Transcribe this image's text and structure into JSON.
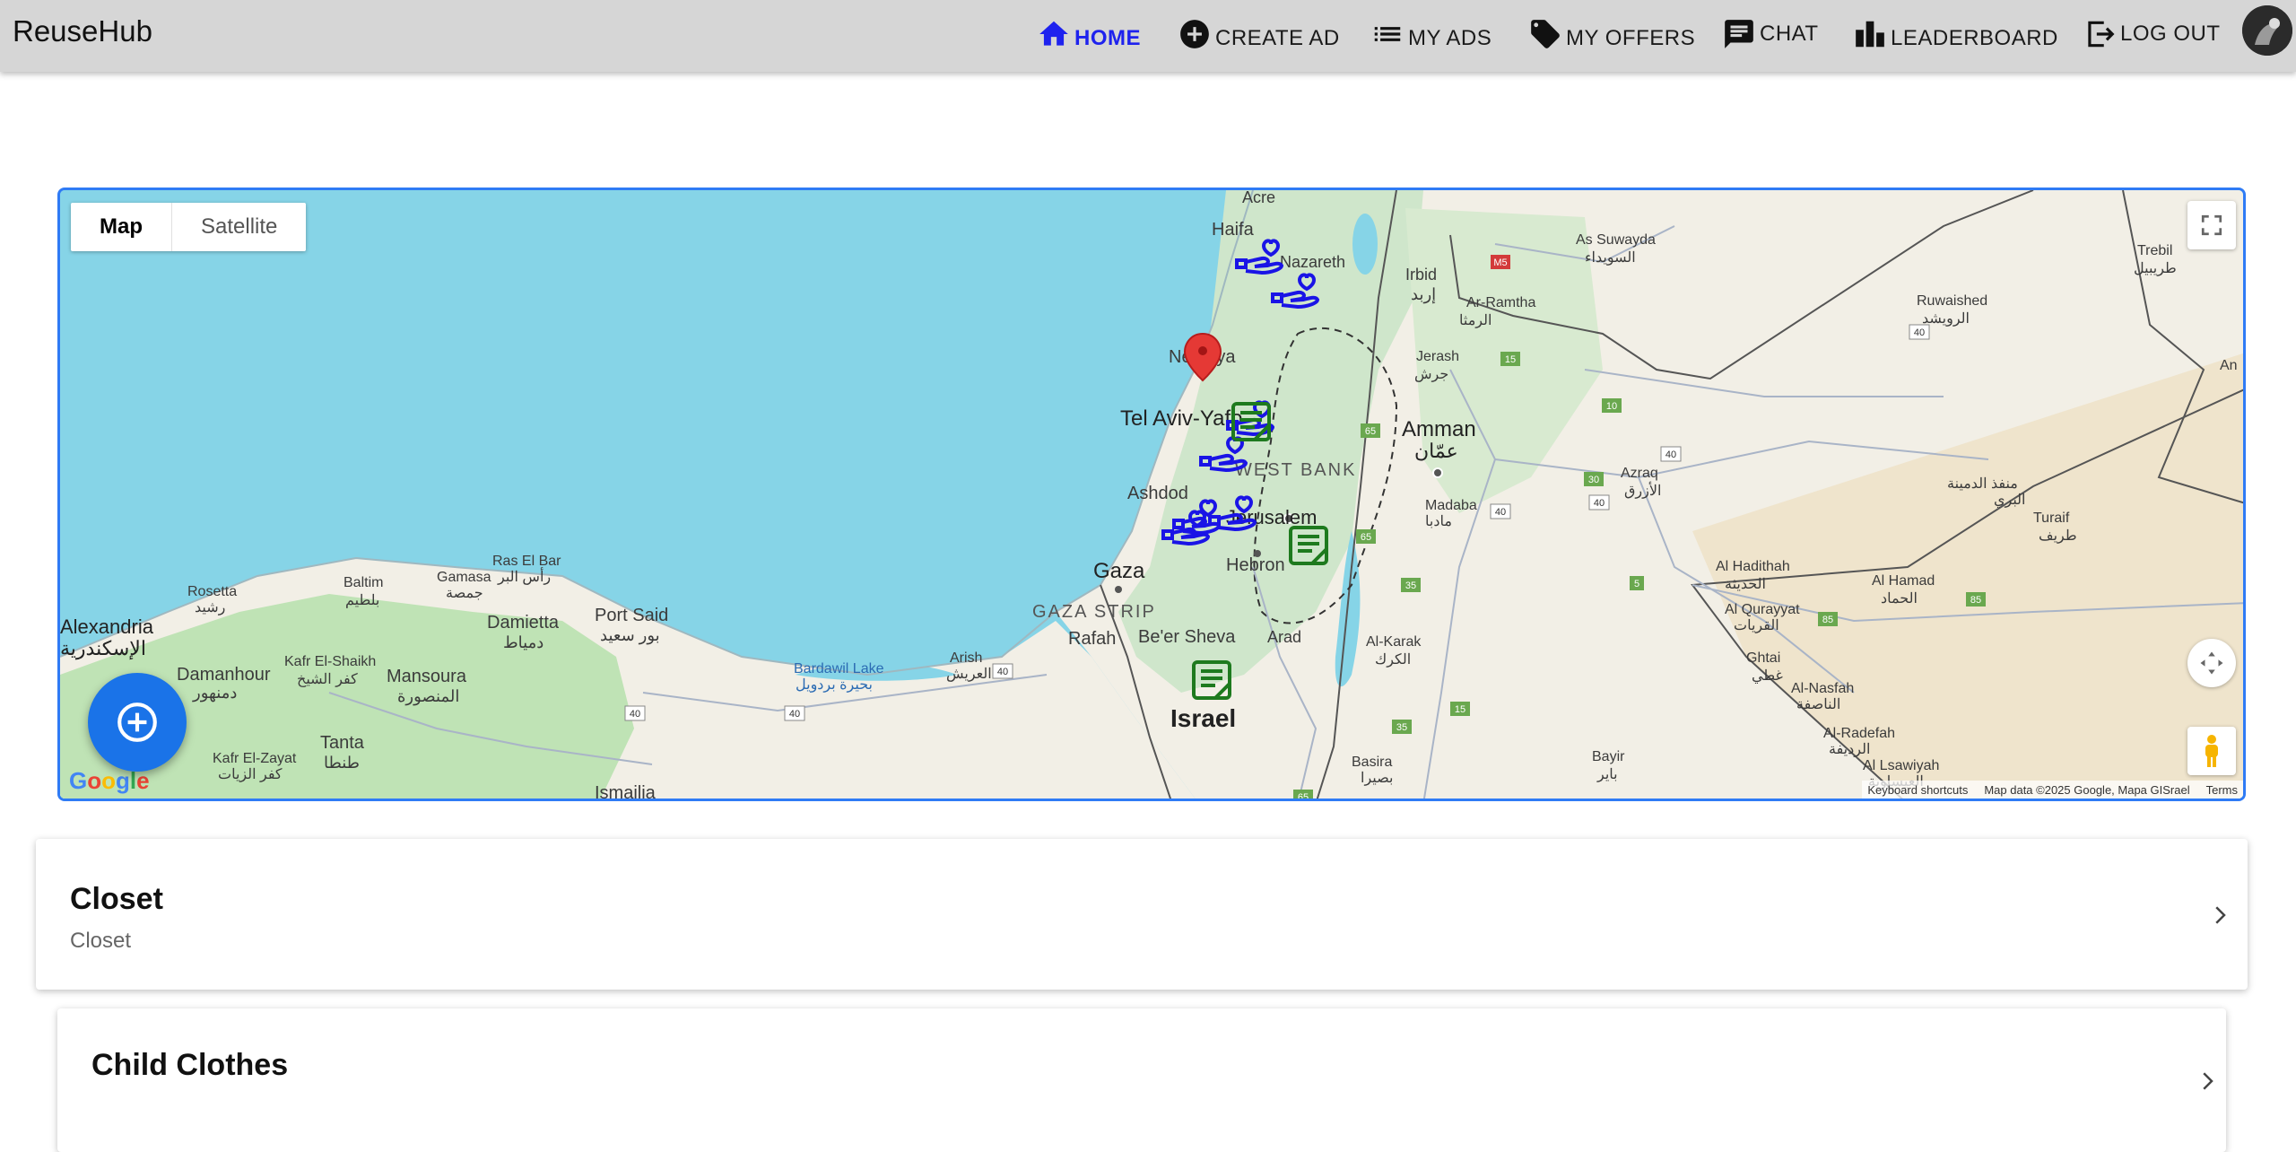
{
  "app": {
    "brand": "ReuseHub"
  },
  "nav": {
    "home": "HOME",
    "create_ad": "CREATE AD",
    "my_ads": "MY ADS",
    "my_offers": "MY OFFERS",
    "chat": "CHAT",
    "leaderboard": "LEADERBOARD",
    "logout": "LOG OUT",
    "active": "home",
    "active_color": "#1e22ee"
  },
  "map": {
    "type_map": "Map",
    "type_satellite": "Satellite",
    "attribution": {
      "shortcuts": "Keyboard shortcuts",
      "data": "Map data ©2025 Google, Mapa GISrael",
      "terms": "Terms"
    },
    "google_logo": "Google",
    "labels": {
      "acre": "Acre",
      "haifa": "Haifa",
      "nazareth": "Nazareth",
      "netanya": "Netanya",
      "tel_aviv": "Tel Aviv-Yafo",
      "ashdod": "Ashdod",
      "jerusalem": "Jerusalem",
      "west_bank": "WEST BANK",
      "gaza": "Gaza",
      "gaza_strip": "GAZA STRIP",
      "rafah": "Rafah",
      "hebron": "Hebron",
      "beer_sheva": "Be'er Sheva",
      "arad": "Arad",
      "israel": "Israel",
      "amman": "Amman",
      "amman_ar": "عمّان",
      "irbid": "Irbid",
      "irbid_ar": "إربد",
      "ar_ramtha": "Ar-Ramtha",
      "ar_ramtha_ar": "الرمثا",
      "jerash": "Jerash",
      "jerash_ar": "جرش",
      "as_suwayda": "As Suwayda",
      "as_suwayda_ar": "السويداء",
      "ruwaished": "Ruwaished",
      "ruwaished_ar": "الرويشد",
      "trebil": "Trebil",
      "trebil_ar": "طريبيل",
      "azraq": "Azraq",
      "azraq_ar": "الأزرق",
      "madaba": "Madaba",
      "madaba_ar": "مادبا",
      "al_karak": "Al-Karak",
      "al_karak_ar": "الكرك",
      "basira": "Basira",
      "basira_ar": "بصيرا",
      "bayir": "Bayir",
      "bayir_ar": "باير",
      "al_hadithah": "Al Hadithah",
      "al_hadithah_ar": "الحديثة",
      "al_qurayyat": "Al Qurayyat",
      "al_qurayyat_ar": "القريات",
      "al_hamad": "Al Hamad",
      "al_hamad_ar": "الحماد",
      "turaif": "Turaif",
      "turaif_ar": "طريف",
      "ghtai": "Ghtai",
      "ghtai_ar": "غطي",
      "al_nasfah": "Al-Nasfah",
      "al_nasfah_ar": "الناصفة",
      "al_radefah": "Al-Radefah",
      "al_radefah_ar": "الرديفة",
      "al_lsawiyah": "Al Lsawiyah",
      "al_lsawiyah_ar": "العيساوية",
      "manfadh": "منفذ الدمينة",
      "manfadh2": "البري",
      "alexandria": "Alexandria",
      "alexandria_ar": "الإسكندرية",
      "rosetta": "Rosetta",
      "rosetta_ar": "رشيد",
      "baltim": "Baltim",
      "baltim_ar": "بلطيم",
      "gamasa": "Gamasa",
      "gamasa_ar": "جمصة",
      "ras_el_bar": "Ras El Bar",
      "ras_el_bar_ar": "رأس البر",
      "damietta": "Damietta",
      "damietta_ar": "دمياط",
      "port_said": "Port Said",
      "port_said_ar": "بور سعيد",
      "damanhour": "Damanhour",
      "damanhour_ar": "دمنهور",
      "kafr_el_shaikh": "Kafr El-Shaikh",
      "kafr_el_shaikh_ar": "كفر الشيخ",
      "mansoura": "Mansoura",
      "mansoura_ar": "المنصورة",
      "tanta": "Tanta",
      "tanta_ar": "طنطا",
      "kafr_el_zayat": "Kafr El-Zayat",
      "kafr_el_zayat_ar": "كفر الزيات",
      "ismailia": "Ismailia",
      "arish": "Arish",
      "arish_ar": "العريش",
      "bardawil": "Bardawil Lake",
      "bardawil_ar": "بحيرة بردويل",
      "an": "An"
    },
    "road_shields": [
      "M5",
      "15",
      "10",
      "40",
      "30",
      "40",
      "40",
      "65",
      "65",
      "35",
      "15",
      "35",
      "65",
      "40",
      "40",
      "40",
      "40",
      "5",
      "85",
      "85"
    ]
  },
  "categories": [
    {
      "title": "Closet",
      "subtitle": "Closet"
    },
    {
      "title": "Child Clothes",
      "subtitle": ""
    }
  ],
  "icons": {
    "donate_marker_color": "#1a14e6",
    "request_marker_color": "#1e7a1e",
    "location_pin_color": "#e53935",
    "fab_color": "#1a73e8"
  }
}
